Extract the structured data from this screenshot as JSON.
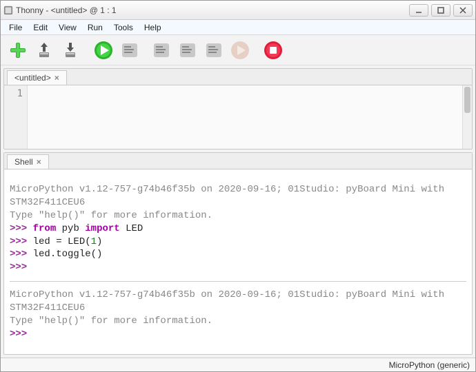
{
  "title": "Thonny  -  <untitled>  @  1 : 1",
  "menu": {
    "file": "File",
    "edit": "Edit",
    "view": "View",
    "run": "Run",
    "tools": "Tools",
    "help": "Help"
  },
  "tabs": {
    "editor": "<untitled>",
    "shell": "Shell"
  },
  "gutter": {
    "line1": "1"
  },
  "shell": {
    "banner1": "MicroPython v1.12-757-g74b46f35b on 2020-09-16; 01Studio: pyBoard Mini with STM32F411CEU6",
    "banner2": "Type \"help()\" for more information.",
    "prompt": ">>>",
    "kw_from": "from",
    "mod_pyb": "pyb",
    "kw_import": "import",
    "mod_led": "LED",
    "line2a": "led = LED(",
    "line2n": "1",
    "line2b": ")",
    "line3": "led.toggle()"
  },
  "status": {
    "interpreter": "MicroPython (generic)"
  }
}
